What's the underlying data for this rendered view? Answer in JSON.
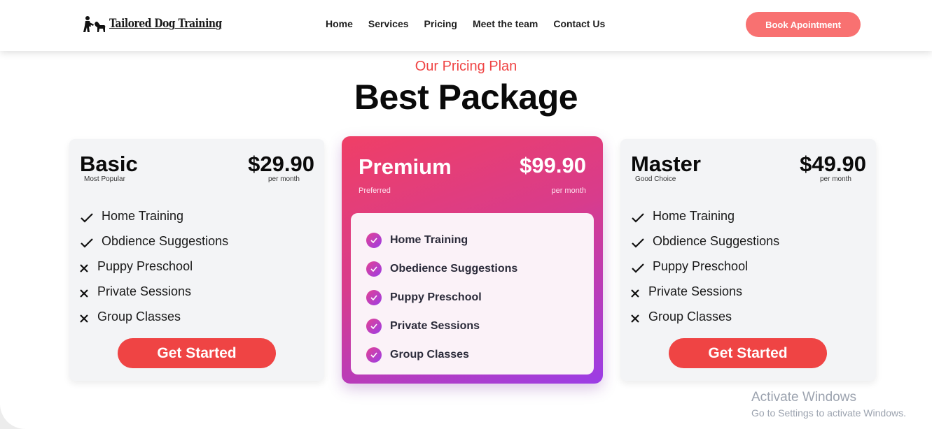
{
  "header": {
    "logo_text": "Tailored Dog Training",
    "nav": [
      "Home",
      "Services",
      "Pricing",
      "Meet the team",
      "Contact Us"
    ],
    "book_label": "Book Apointment"
  },
  "hero": {
    "subtitle": "Our Pricing Plan",
    "title": "Best Package"
  },
  "plans": [
    {
      "name": "Basic",
      "tag": "Most Popular",
      "price": "$29.90",
      "per": "per month",
      "features": [
        {
          "label": "Home Training",
          "included": true
        },
        {
          "label": "Obdience Suggestions",
          "included": true
        },
        {
          "label": "Puppy Preschool",
          "included": false
        },
        {
          "label": "Private Sessions",
          "included": false
        },
        {
          "label": "Group Classes",
          "included": false
        }
      ],
      "cta": "Get Started"
    },
    {
      "name": "Premium",
      "tag": "Preferred",
      "price": "$99.90",
      "per": "per month",
      "features": [
        {
          "label": "Home Training",
          "included": true
        },
        {
          "label": "Obedience Suggestions",
          "included": true
        },
        {
          "label": "Puppy Preschool",
          "included": true
        },
        {
          "label": "Private Sessions",
          "included": true
        },
        {
          "label": "Group Classes",
          "included": true
        }
      ]
    },
    {
      "name": "Master",
      "tag": "Good Choice",
      "price": "$49.90",
      "per": "per month",
      "features": [
        {
          "label": "Home Training",
          "included": true
        },
        {
          "label": "Obdience Suggestions",
          "included": true
        },
        {
          "label": "Puppy Preschool",
          "included": true
        },
        {
          "label": "Private Sessions",
          "included": false
        },
        {
          "label": "Group Classes",
          "included": false
        }
      ],
      "cta": "Get Started"
    }
  ],
  "watermark": {
    "line1": "Activate Windows",
    "line2": "Go to Settings to activate Windows."
  },
  "colors": {
    "accent": "#ef4444",
    "book_button": "#f87171",
    "premium_gradient_start": "#ef3f66",
    "premium_gradient_end": "#9b3de6"
  },
  "icons": {
    "included": "check-icon",
    "excluded": "cross-icon",
    "premium_included": "check-circle-icon"
  }
}
